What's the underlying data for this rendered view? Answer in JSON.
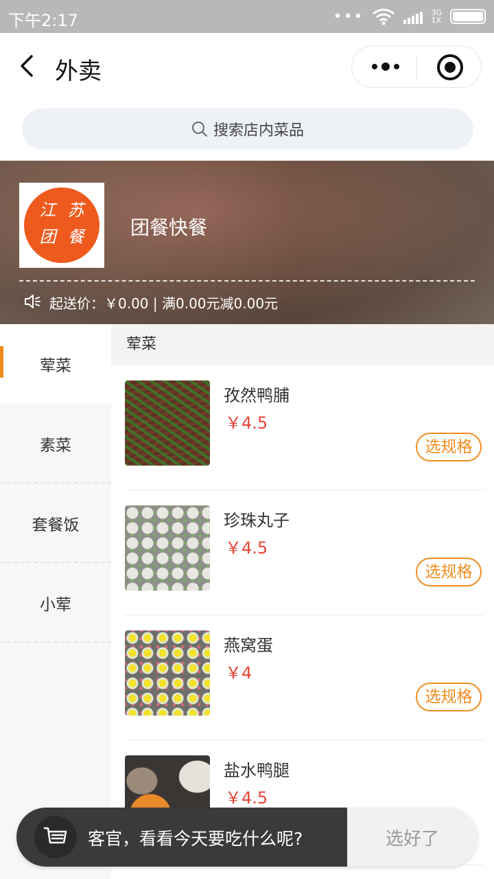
{
  "status_bar": {
    "time": "下午2:17",
    "network_top": "3G",
    "network_bottom": "1X"
  },
  "nav": {
    "title": "外卖"
  },
  "search": {
    "placeholder": "搜索店内菜品"
  },
  "store": {
    "logo_chars": [
      "江",
      "苏",
      "团",
      "餐"
    ],
    "name": "团餐快餐",
    "notice": "起送价：￥0.00 | 满0.00元减0.00元"
  },
  "sidebar": {
    "items": [
      {
        "label": "荤菜",
        "active": true
      },
      {
        "label": "素菜",
        "active": false
      },
      {
        "label": "套餐饭",
        "active": false
      },
      {
        "label": "小荤",
        "active": false
      }
    ]
  },
  "content": {
    "category_title": "荤菜",
    "spec_label": "选规格",
    "dishes": [
      {
        "name": "孜然鸭脯",
        "price": "￥4.5"
      },
      {
        "name": "珍珠丸子",
        "price": "￥4.5"
      },
      {
        "name": "燕窝蛋",
        "price": "￥4"
      },
      {
        "name": "盐水鸭腿",
        "price": "￥4.5"
      }
    ]
  },
  "cart": {
    "prompt": "客官，看看今天要吃什么呢?",
    "confirm_label": "选好了"
  },
  "colors": {
    "accent": "#f08c1f",
    "price": "#e8443a",
    "logo": "#ee5a1e"
  }
}
